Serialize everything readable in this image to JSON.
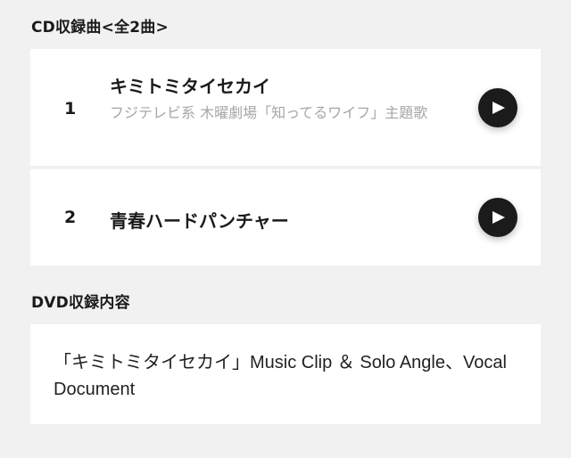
{
  "cd_section": {
    "title": "CD収録曲<全2曲>",
    "tracks": [
      {
        "number": "1",
        "title": "キミトミタイセカイ",
        "subtitle": "フジテレビ系 木曜劇場「知ってるワイフ」主題歌",
        "play_icon": "play-icon"
      },
      {
        "number": "2",
        "title": "青春ハードパンチャー",
        "subtitle": "",
        "play_icon": "play-icon"
      }
    ]
  },
  "dvd_section": {
    "title": "DVD収録内容",
    "content": "「キミトミタイセカイ」Music Clip ＆ Solo Angle、Vocal Document"
  }
}
